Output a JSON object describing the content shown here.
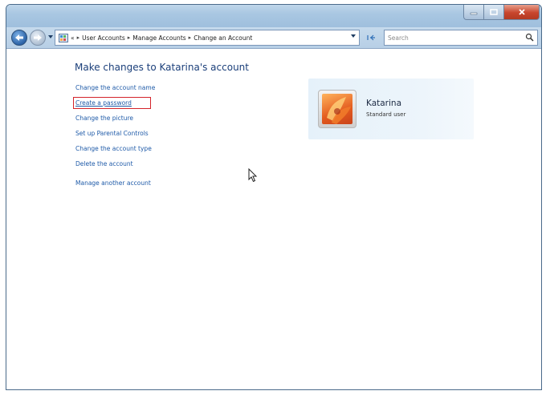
{
  "window": {
    "breadcrumbs": [
      "User Accounts",
      "Manage Accounts",
      "Change an Account"
    ],
    "overflow": "«",
    "search_placeholder": "Search"
  },
  "page": {
    "heading": "Make changes to Katarina's account",
    "links": [
      "Change the account name",
      "Create a password",
      "Change the picture",
      "Set up Parental Controls",
      "Change the account type",
      "Delete the account",
      "Manage another account"
    ]
  },
  "account": {
    "name": "Katarina",
    "type": "Standard user"
  },
  "colors": {
    "link": "#1e5aa8",
    "heading": "#1b3f7a",
    "highlight": "#d4232a"
  }
}
